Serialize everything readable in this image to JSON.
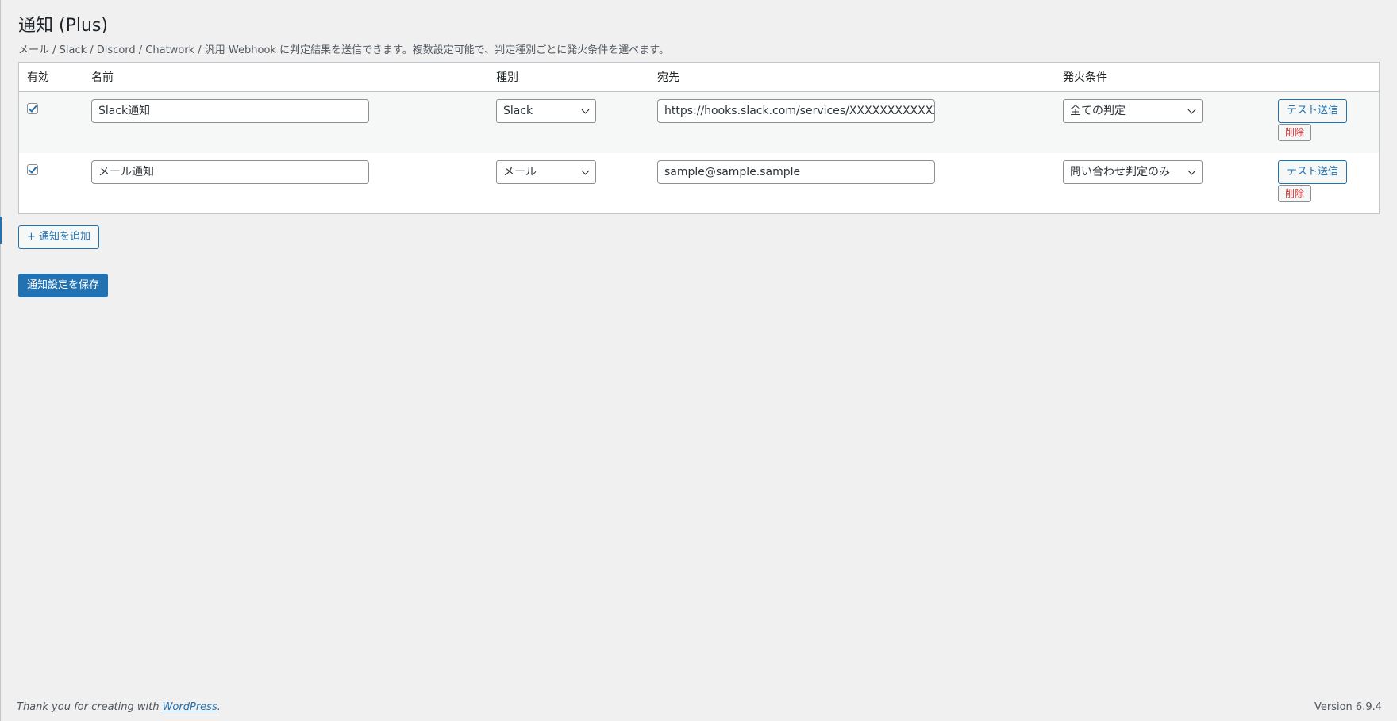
{
  "page": {
    "title": "通知 (Plus)",
    "description": "メール / Slack / Discord / Chatwork / 汎用 Webhook に判定結果を送信できます。複数設定可能で、判定種別ごとに発火条件を選べます。"
  },
  "table": {
    "headers": {
      "enabled": "有効",
      "name": "名前",
      "type": "種別",
      "destination": "宛先",
      "trigger": "発火条件"
    },
    "rows": [
      {
        "enabled": true,
        "name": "Slack通知",
        "type": "Slack",
        "destination": "https://hooks.slack.com/services/XXXXXXXXXXXXXXXXX",
        "trigger": "全ての判定",
        "test_label": "テスト送信",
        "delete_label": "削除"
      },
      {
        "enabled": true,
        "name": "メール通知",
        "type": "メール",
        "destination": "sample@sample.sample",
        "trigger": "問い合わせ判定のみ",
        "test_label": "テスト送信",
        "delete_label": "削除"
      }
    ]
  },
  "actions": {
    "add_label": "+ 通知を追加",
    "save_label": "通知設定を保存"
  },
  "footer": {
    "thanks_prefix": "Thank you for creating with ",
    "wordpress_link": "WordPress",
    "thanks_suffix": ".",
    "version": "Version 6.9.4"
  },
  "colors": {
    "accent": "#2271b1",
    "danger": "#d63638",
    "background": "#f0f0f1"
  }
}
